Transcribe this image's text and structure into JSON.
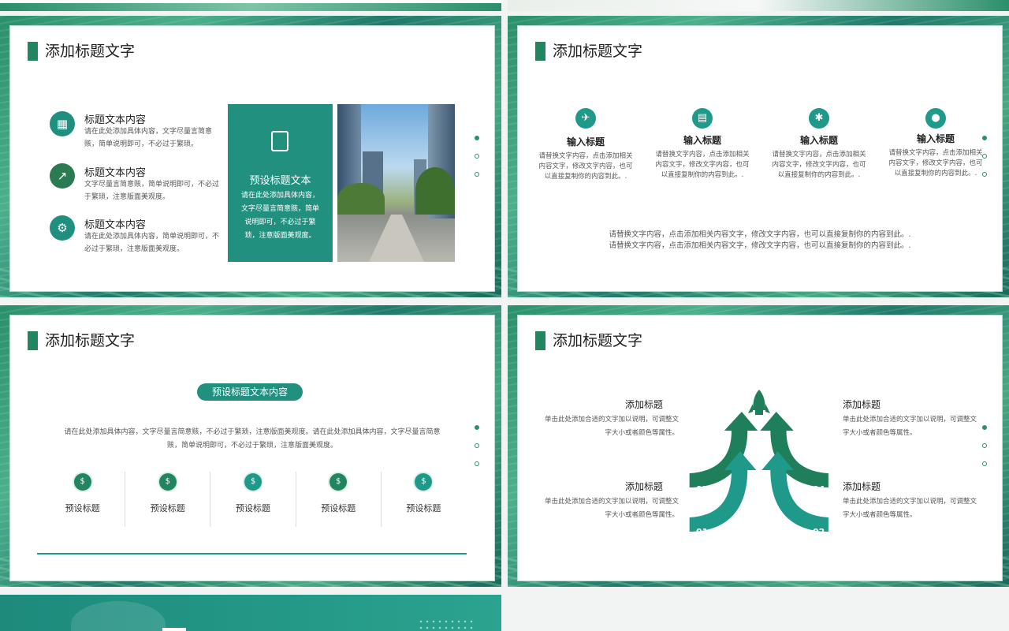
{
  "slides": {
    "s1": {
      "title": "添加标题文字",
      "items": [
        {
          "title": "标题文本内容",
          "text": "请在此处添加具体内容，文字尽量言简意赅，简单说明即可，不必过于繁琐。",
          "icon": "calendar-check-icon"
        },
        {
          "title": "标题文本内容",
          "text": "文字尽量言简意赅，简单说明即可，不必过于繁琐，注意版面美观度。",
          "icon": "chart-up-icon"
        },
        {
          "title": "标题文本内容",
          "text": "请在此处添加具体内容，简单说明即可，不必过于繁琐，注意版面美观度。",
          "icon": "gear-card-icon"
        }
      ],
      "box_title": "预设标题文本",
      "box_text": "请在此处添加具体内容，文字尽量言简意赅，简单说明即可，不必过于繁琐，注意版面美观度。"
    },
    "s2": {
      "title": "添加标题文字",
      "items": [
        {
          "title": "输入标题",
          "text": "请替换文字内容，点击添加相关内容文字，修改文字内容，也可以直接复制你的内容到此。.",
          "icon": "plane-icon"
        },
        {
          "title": "输入标题",
          "text": "请替换文字内容，点击添加相关内容文字，修改文字内容，也可以直接复制你的内容到此。.",
          "icon": "document-icon"
        },
        {
          "title": "输入标题",
          "text": "请替换文字内容，点击添加相关内容文字，修改文字内容，也可以直接复制你的内容到此。.",
          "icon": "star-icon"
        },
        {
          "title": "输入标题",
          "text": "请替换文字内容，点击添加相关内容文字，修改文字内容，也可以直接复制你的内容到此。.",
          "icon": "person-icon"
        }
      ],
      "bottom_line1": "请替换文字内容，点击添加相关内容文字，修改文字内容，也可以直接复制你的内容到此。.",
      "bottom_line2": "请替换文字内容，点击添加相关内容文字，修改文字内容，也可以直接复制你的内容到此。."
    },
    "s3": {
      "title": "添加标题文字",
      "pill": "预设标题文本内容",
      "text": "请在此处添加具体内容，文字尽量言简意赅，不必过于繁琐，注意版面美观度。请在此处添加具体内容，文字尽量言简意赅，简单说明即可，不必过于繁琐，注意版面美观度。",
      "items": [
        "预设标题",
        "预设标题",
        "预设标题",
        "预设标题",
        "预设标题"
      ]
    },
    "s4": {
      "title": "添加标题文字",
      "blocks": [
        {
          "title": "添加标题",
          "text": "单击此处添加合适的文字加以说明，可调整文字大小或者颜色等属性。"
        },
        {
          "title": "添加标题",
          "text": "单击此处添加合适的文字加以说明，可调整文字大小或者颜色等属性。"
        },
        {
          "title": "添加标题",
          "text": "单击此处添加合适的文字加以说明，可调整文字大小或者颜色等属性。"
        },
        {
          "title": "添加标题",
          "text": "单击此处添加合适的文字加以说明，可调整文字大小或者颜色等属性。"
        }
      ],
      "nums": [
        "03",
        "04",
        "01",
        "02"
      ]
    }
  },
  "colors": {
    "primary": "#21865f",
    "teal": "#1f9a8a"
  }
}
